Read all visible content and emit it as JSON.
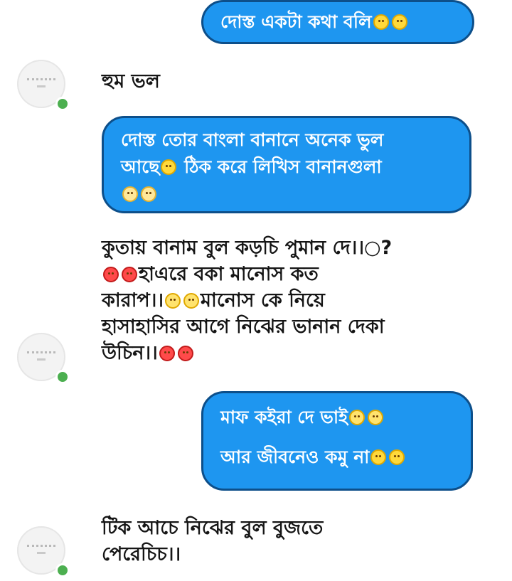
{
  "colors": {
    "outgoing_bubble": "#1e96f0",
    "outgoing_border": "#0d4f8a",
    "online_status": "#4caf50"
  },
  "messages": [
    {
      "direction": "outgoing",
      "lines": [
        "দোস্ত একটা কথা বলি"
      ],
      "emojis": [
        "smile-emoji",
        "smile-emoji"
      ]
    },
    {
      "direction": "incoming",
      "lines": [
        "হুম ভল"
      ]
    },
    {
      "direction": "outgoing",
      "lines": [
        "দোস্ত তোর বাংলা বানানে অনেক ভুল",
        "আছে",
        "ঠিক করে লিখিস বানানগুলা"
      ],
      "emojis": [
        "smile-emoji",
        "blush-emoji",
        "blush-emoji"
      ]
    },
    {
      "direction": "incoming",
      "lines": [
        "কুতায় বানাম বুল কড়চি পুমান দে।।○?",
        "হাএরে বকা মানোস কত",
        "কারাপ।।",
        "মানোস কে নিয়ে",
        "হাসাহাসির আগে নিঝের ভানান দেকা",
        "উচিন।।"
      ],
      "emojis": [
        "angry-emoji",
        "sad-emoji"
      ]
    },
    {
      "direction": "outgoing",
      "lines": [
        "মাফ কইরা দে ভাই",
        "আর জীবনেও কমু না"
      ],
      "emojis": [
        "sad-emoji",
        "smile-emoji"
      ]
    },
    {
      "direction": "incoming",
      "lines": [
        "টিক আচে নিঝের বুল বুজতে",
        "পেরেচিচ।।"
      ]
    }
  ]
}
